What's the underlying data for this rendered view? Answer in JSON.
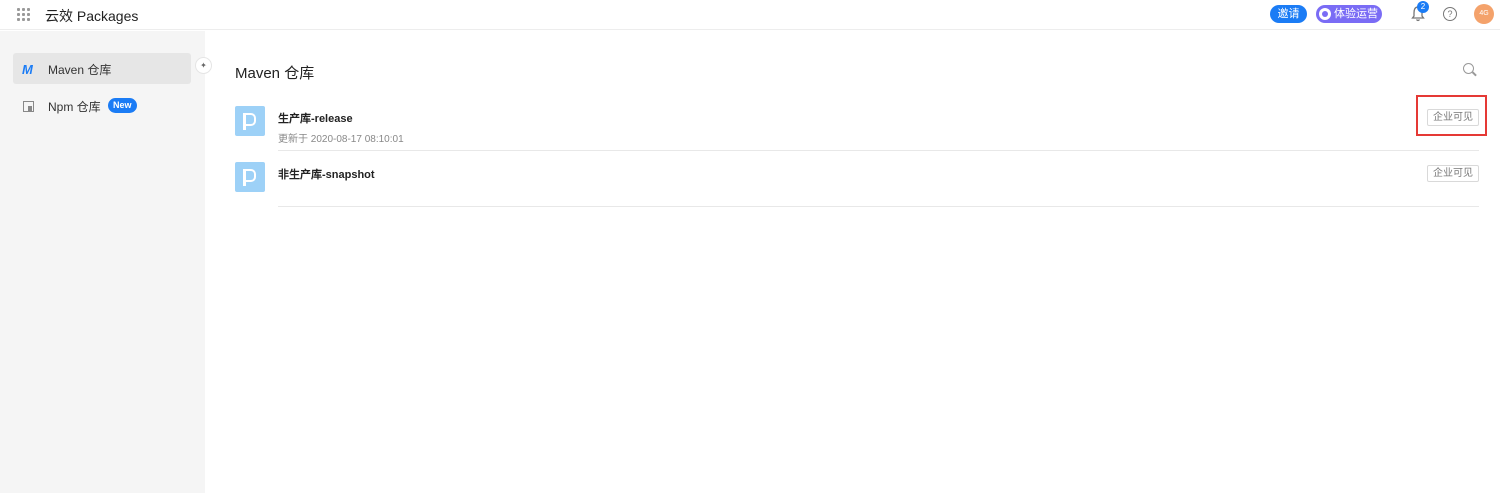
{
  "app": {
    "title": "云效 Packages"
  },
  "header": {
    "invite_label": "邀请",
    "trial_label": "体验运营",
    "notification_count": "2",
    "help_symbol": "?",
    "avatar_text": "4G"
  },
  "sidebar": {
    "items": [
      {
        "label": "Maven 仓库",
        "icon": "maven-icon",
        "active": true
      },
      {
        "label": "Npm 仓库",
        "icon": "npm-icon",
        "badge": "New",
        "active": false
      }
    ],
    "pin_symbol": "✦"
  },
  "main": {
    "title": "Maven 仓库",
    "repositories": [
      {
        "name": "生产库-release",
        "updated": "更新于 2020-08-17 08:10:01",
        "visibility": "企业可见"
      },
      {
        "name": "非生产库-snapshot",
        "updated": "",
        "visibility": "企业可见"
      }
    ]
  },
  "colors": {
    "primary": "#1b7cf5",
    "trial": "#7a6cf5",
    "avatar": "#f4a26b",
    "highlight": "#e53935"
  }
}
